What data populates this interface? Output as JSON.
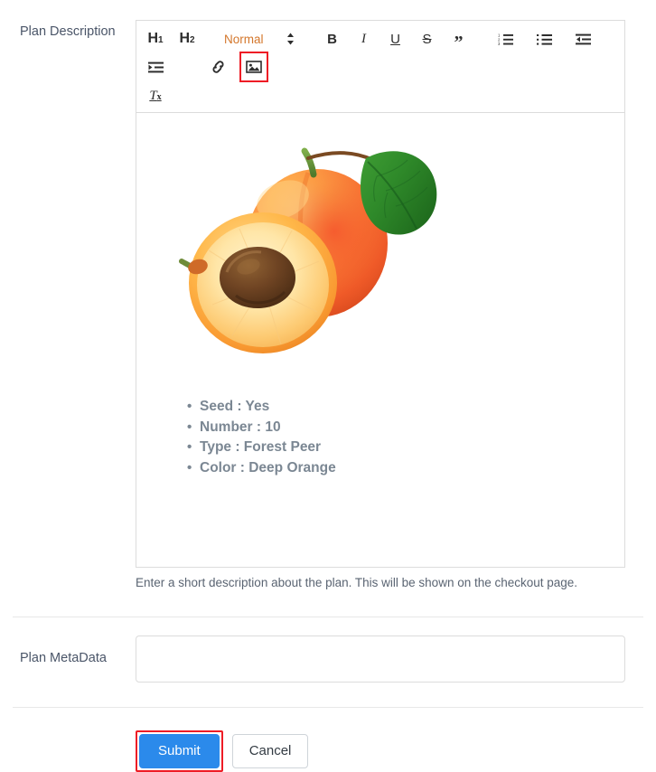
{
  "form": {
    "description": {
      "label": "Plan Description",
      "help_text": "Enter a short description about the plan. This will be shown on the checkout page."
    },
    "metadata": {
      "label": "Plan MetaData",
      "value": "",
      "placeholder": ""
    }
  },
  "editor": {
    "toolbar": {
      "heading1": "H1",
      "heading1_base": "H",
      "heading1_sub": "1",
      "heading2_base": "H",
      "heading2_sub": "2",
      "format_select": "Normal",
      "bold": "B",
      "italic": "I",
      "underline": "U",
      "strikethrough": "S",
      "blockquote": "”",
      "clear_format_base": "T",
      "clear_format_sub": "x",
      "items": [
        "header-1",
        "header-2",
        "format-select",
        "bold",
        "italic",
        "underline",
        "strikethrough",
        "blockquote",
        "ordered-list",
        "bullet-list",
        "outdent",
        "indent",
        "link",
        "image",
        "clear-formatting"
      ],
      "active_item": "image",
      "highlight_color": "#ee1c25"
    },
    "content": {
      "image_alt": "apricot fruit photo",
      "bullets": [
        "Seed : Yes",
        "Number : 10",
        "Type : Forest Peer",
        "Color : Deep Orange"
      ]
    }
  },
  "actions": {
    "submit_label": "Submit",
    "cancel_label": "Cancel",
    "submit_color": "#2b8aeb",
    "highlight_color": "#ee1c25"
  }
}
